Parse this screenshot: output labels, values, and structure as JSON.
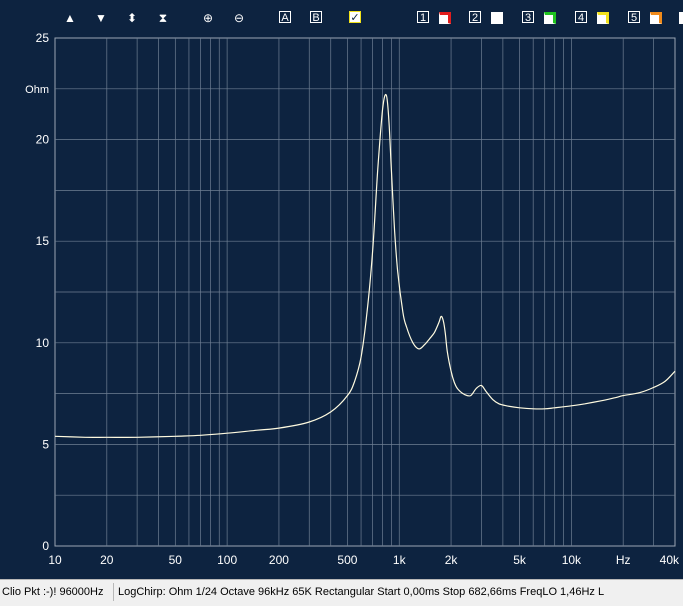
{
  "toolbar": {
    "buttons": [
      {
        "name": "scroll-up-icon",
        "glyph": "▲"
      },
      {
        "name": "scroll-down-icon",
        "glyph": "▼"
      },
      {
        "name": "expand-vertical-icon",
        "glyph": "⬍"
      },
      {
        "name": "compress-vertical-icon",
        "glyph": "⧗"
      },
      {
        "name": "zoom-in-icon",
        "glyph": "⊕"
      },
      {
        "name": "zoom-out-icon",
        "glyph": "⊖"
      }
    ],
    "marker_a": "A",
    "marker_b": "B",
    "check_icon": "checkbox-icon",
    "overlays": [
      {
        "label": "1",
        "color": "#e21d1d"
      },
      {
        "label": "2",
        "color": "#ffffff"
      },
      {
        "label": "3",
        "color": "#1fc31f"
      },
      {
        "label": "4",
        "color": "#f2e21a"
      },
      {
        "label": "5",
        "color": "#f08a1a"
      }
    ]
  },
  "chart_data": {
    "type": "line",
    "xscale": "log",
    "xlim": [
      10,
      40000
    ],
    "ylim": [
      0,
      25
    ],
    "ylabel": "Ohm",
    "xlabel": "Hz",
    "grid": true,
    "yticks": [
      0,
      5,
      10,
      15,
      20,
      25
    ],
    "xticklabels": [
      {
        "v": 10,
        "t": "10"
      },
      {
        "v": 20,
        "t": "20"
      },
      {
        "v": 50,
        "t": "50"
      },
      {
        "v": 100,
        "t": "100"
      },
      {
        "v": 200,
        "t": "200"
      },
      {
        "v": 500,
        "t": "500"
      },
      {
        "v": 1000,
        "t": "1k"
      },
      {
        "v": 2000,
        "t": "2k"
      },
      {
        "v": 5000,
        "t": "5k"
      },
      {
        "v": 10000,
        "t": "10k"
      },
      {
        "v": 40000,
        "t": "40k"
      }
    ],
    "series": [
      {
        "color": "#fffbe0",
        "x": [
          10,
          15,
          20,
          30,
          50,
          70,
          100,
          150,
          200,
          300,
          400,
          500,
          550,
          600,
          650,
          700,
          750,
          800,
          840,
          870,
          900,
          940,
          980,
          1050,
          1100,
          1200,
          1300,
          1400,
          1500,
          1600,
          1700,
          1750,
          1800,
          1850,
          1900,
          2000,
          2100,
          2200,
          2400,
          2600,
          2800,
          3000,
          3200,
          3500,
          3800,
          4200,
          5000,
          6000,
          7000,
          8000,
          10000,
          12000,
          15000,
          18000,
          20000,
          25000,
          30000,
          35000,
          40000
        ],
        "y": [
          5.4,
          5.35,
          5.35,
          5.35,
          5.4,
          5.45,
          5.55,
          5.7,
          5.8,
          6.1,
          6.6,
          7.4,
          8.1,
          9.3,
          11.5,
          14.5,
          18.5,
          21.5,
          22.2,
          21.0,
          18.5,
          15.5,
          13.5,
          11.5,
          10.8,
          10.0,
          9.7,
          9.9,
          10.2,
          10.5,
          11.0,
          11.3,
          11.1,
          10.5,
          9.6,
          8.6,
          8.0,
          7.7,
          7.45,
          7.4,
          7.75,
          7.9,
          7.6,
          7.2,
          7.0,
          6.9,
          6.8,
          6.75,
          6.75,
          6.8,
          6.9,
          7.0,
          7.15,
          7.3,
          7.4,
          7.55,
          7.8,
          8.1,
          8.6
        ]
      }
    ]
  },
  "status": {
    "items": [
      "Clio Pkt :-)! 96000Hz",
      "LogChirp:  Ohm   1/24 Octave   96kHz   65K   Rectangular   Start 0,00ms    Stop 682,66ms    FreqLO 1,46Hz   L"
    ]
  }
}
